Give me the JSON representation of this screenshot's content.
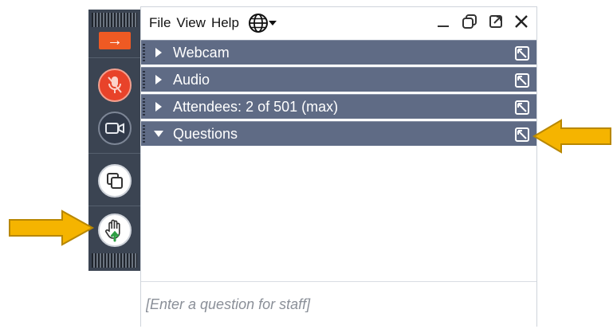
{
  "menu": {
    "file": "File",
    "view": "View",
    "help": "Help"
  },
  "sections": [
    {
      "label": "Webcam",
      "expanded": false
    },
    {
      "label": "Audio",
      "expanded": false
    },
    {
      "label": "Attendees:  2 of 501 (max)",
      "expanded": false
    },
    {
      "label": "Questions",
      "expanded": true
    }
  ],
  "question_input": {
    "placeholder": "[Enter a question for staff]"
  },
  "toolbar": {
    "collapse_glyph": "→"
  },
  "icons": {
    "collapse": "arrow-right-icon",
    "mic": "mic-muted-icon",
    "camera": "camera-icon",
    "share": "screen-share-icon",
    "hand": "raise-hand-icon",
    "globe": "globe-icon",
    "minimize": "minimize-icon",
    "restore": "restore-icon",
    "popout": "popout-icon",
    "close": "close-icon"
  },
  "colors": {
    "toolbar_bg": "#3b4452",
    "section_bg": "#5f6b85",
    "accent_orange": "#ef5a23",
    "mic_red": "#e8432a",
    "hand_green": "#2e9e44",
    "annotation_arrow": "#f5b400"
  }
}
